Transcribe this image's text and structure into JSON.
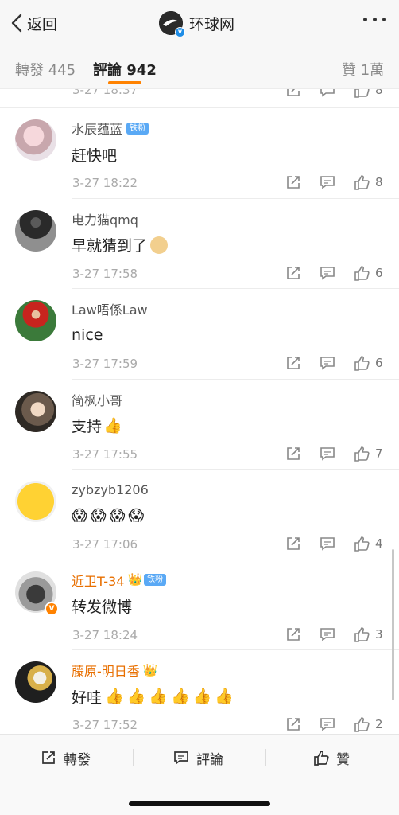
{
  "nav": {
    "back_label": "返回",
    "title": "环球网",
    "more_icon": "more-dots-icon"
  },
  "tabs": [
    {
      "label": "轉發 445"
    },
    {
      "label": "評論 942"
    },
    {
      "label": "贊 1萬"
    }
  ],
  "partial_row": {
    "time": "3-27 18:37",
    "likes": "8"
  },
  "comments": [
    {
      "user": "水辰蕴蓝",
      "badge": "铁粉",
      "text": "赶快吧",
      "emojis": "",
      "time": "3-27 18:22",
      "likes": "8"
    },
    {
      "user": "电力猫qmq",
      "badge": "",
      "text": "早就猜到了",
      "emojis": "",
      "time": "3-27 17:58",
      "likes": "6"
    },
    {
      "user": "Law唔係Law",
      "badge": "",
      "text": "nice",
      "emojis": "",
      "time": "3-27 17:59",
      "likes": "6"
    },
    {
      "user": "简枫小哥",
      "badge": "",
      "text": "支持",
      "emojis": "👍",
      "time": "3-27 17:55",
      "likes": "7"
    },
    {
      "user": "zybzyb1206",
      "badge": "",
      "text": "",
      "emojis": "😱😱😱😱",
      "time": "3-27 17:06",
      "likes": "4"
    },
    {
      "user": "近卫T-34",
      "badge": "铁粉",
      "text": "转发微博",
      "emojis": "",
      "time": "3-27 18:24",
      "likes": "3"
    },
    {
      "user": "藤原-明日香",
      "badge": "",
      "text": "好哇",
      "emojis": "👍👍👍👍👍👍",
      "time": "3-27 17:52",
      "likes": "2"
    }
  ],
  "bottom_bar": {
    "repost_label": "轉發",
    "comment_label": "評論",
    "like_label": "贊"
  },
  "colors": {
    "accent": "#ff8200",
    "fan_badge": "#5aa9f5",
    "verified": "#1f8de6",
    "vip_name": "#e86f00"
  }
}
